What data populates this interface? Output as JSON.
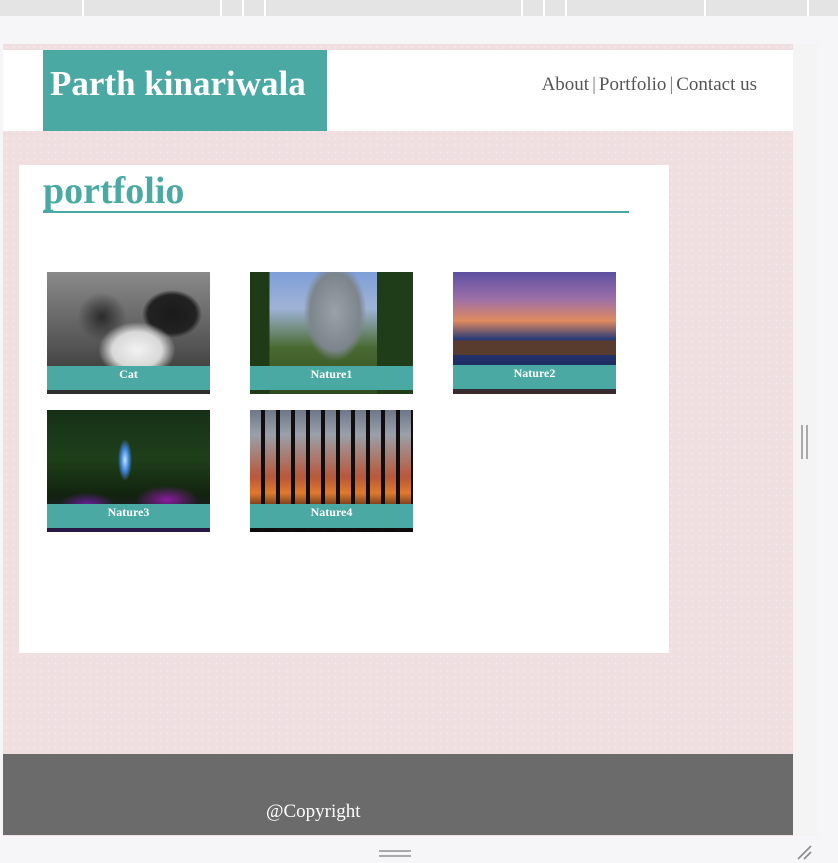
{
  "site": {
    "brand": "Parth kinariwala"
  },
  "nav": {
    "items": [
      "About",
      "Portfolio",
      "Contact us"
    ],
    "separator": "|"
  },
  "portfolio": {
    "heading": "portfolio",
    "items": [
      {
        "caption": "Cat"
      },
      {
        "caption": "Nature1"
      },
      {
        "caption": "Nature2"
      },
      {
        "caption": "Nature3"
      },
      {
        "caption": "Nature4"
      }
    ]
  },
  "footer": {
    "copyright": "@Copyright"
  },
  "colors": {
    "accent": "#4aa9a3",
    "background": "#f0dfe1",
    "footer": "#6b6b6b"
  }
}
